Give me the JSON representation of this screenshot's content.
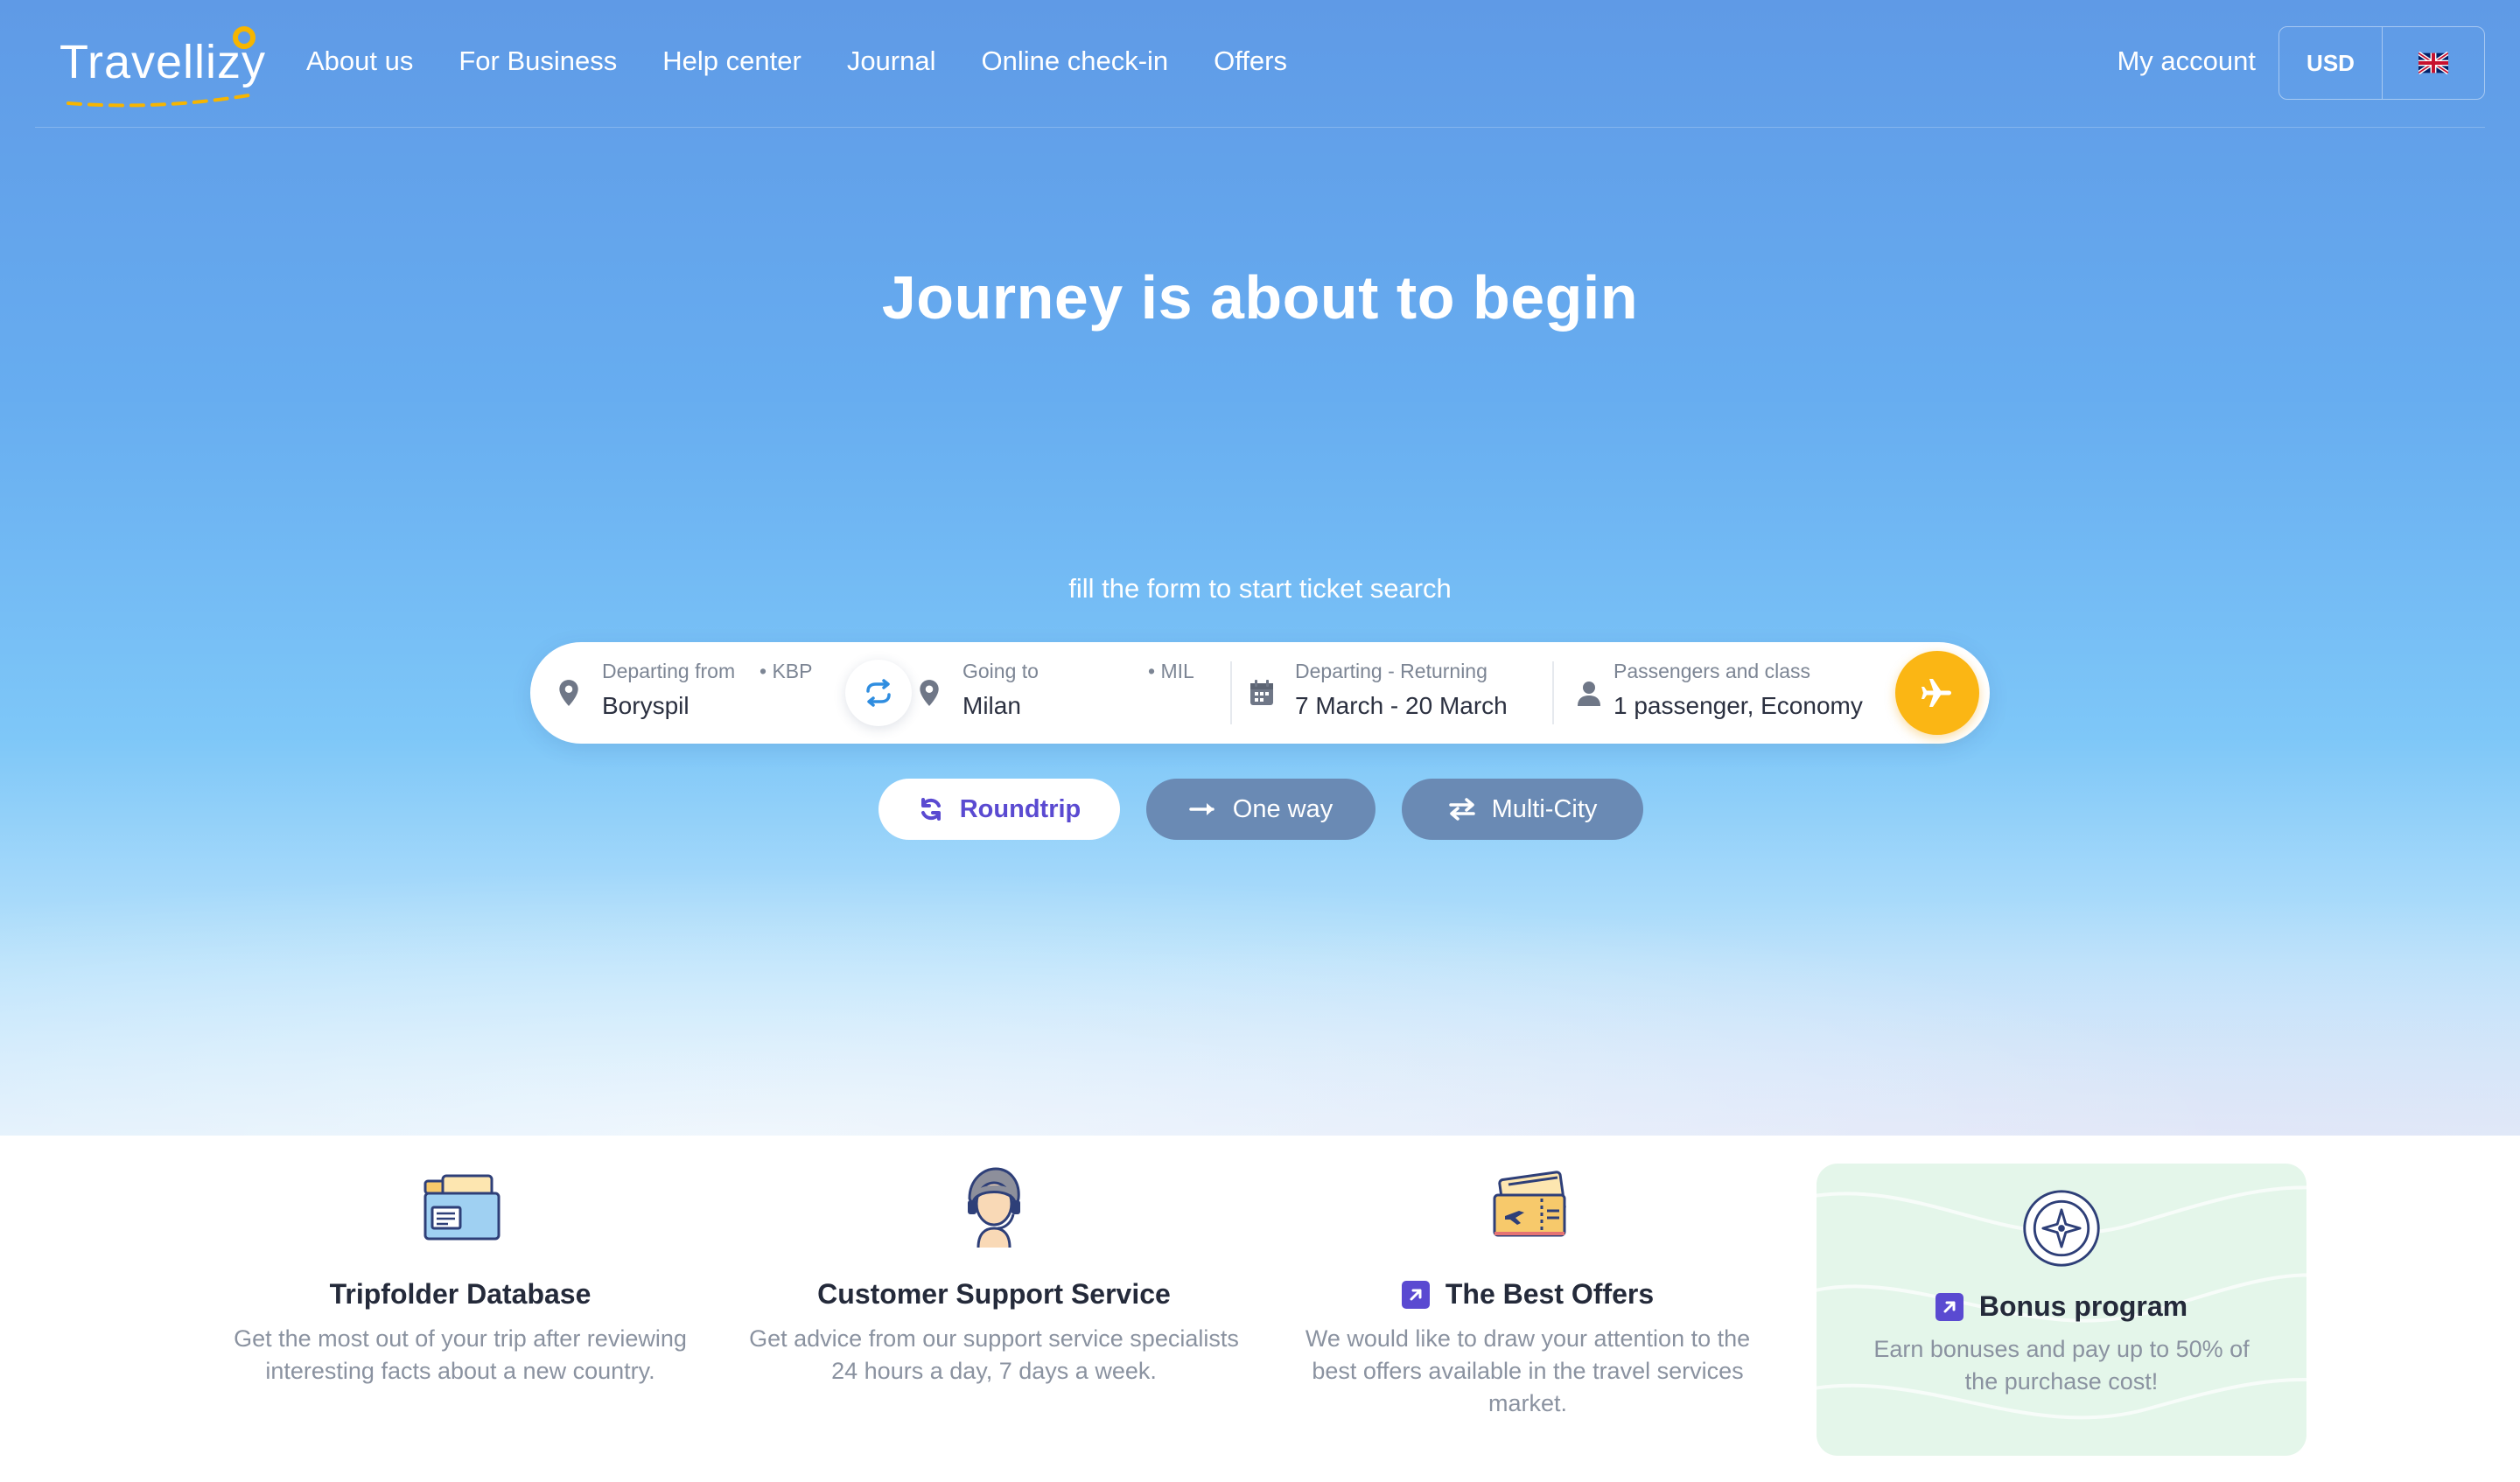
{
  "brand": {
    "name": "Travellizy"
  },
  "nav": {
    "items": [
      "About us",
      "For Business",
      "Help center",
      "Journal",
      "Online check-in",
      "Offers"
    ]
  },
  "header": {
    "account_label": "My account",
    "currency": "USD",
    "language_icon": "uk-flag-icon"
  },
  "hero": {
    "headline": "Journey is about to begin",
    "subline": "fill the form to start ticket search"
  },
  "search": {
    "from": {
      "label": "Departing from",
      "code": "• KBP",
      "value": "Boryspil"
    },
    "to": {
      "label": "Going to",
      "code": "• MIL",
      "value": "Milan"
    },
    "dates": {
      "label": "Departing - Returning",
      "value": "7 March - 20 March"
    },
    "passengers": {
      "label": "Passengers and class",
      "value": "1 passenger, Economy"
    }
  },
  "trip_types": [
    {
      "label": "Roundtrip",
      "active": true
    },
    {
      "label": "One way",
      "active": false
    },
    {
      "label": "Multi-City",
      "active": false
    }
  ],
  "features": [
    {
      "title": "Tripfolder Database",
      "text": "Get the most out of your trip after reviewing interesting facts about a new country."
    },
    {
      "title": "Customer Support Service",
      "text": "Get advice from our support service specialists 24 hours a day, 7 days a week."
    },
    {
      "title": "The Best Offers",
      "text": "We would like to draw your attention to the best offers available in the travel services market."
    },
    {
      "title": "Bonus program",
      "text": "Earn bonuses and pay up to 50% of the purchase cost!"
    }
  ],
  "colors": {
    "accent": "#fbb614",
    "primary": "#5a4ad1",
    "inactive_pill": "#6a8ab4"
  }
}
